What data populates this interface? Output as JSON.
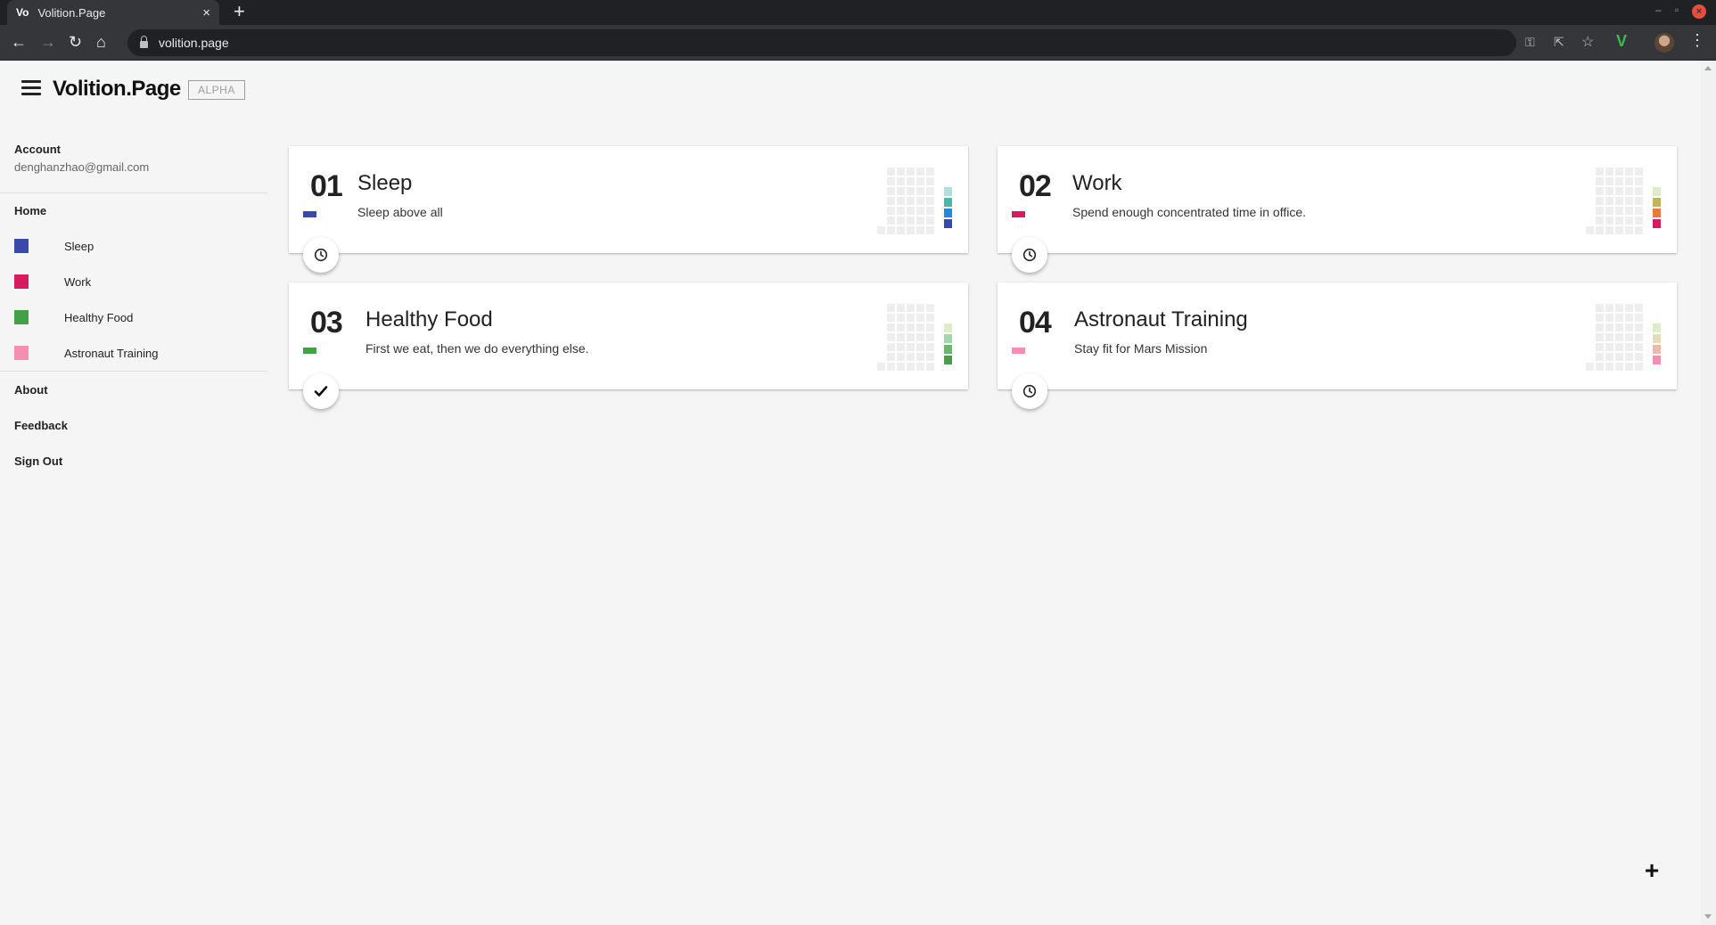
{
  "browser": {
    "tab_favicon": "Vo",
    "tab_title": "Volition.Page",
    "tab_close": "×",
    "new_tab": "+",
    "url": "volition.page",
    "icons": {
      "back": "←",
      "forward": "→",
      "reload": "↻",
      "home": "⌂",
      "key": "⚿",
      "share": "⇱",
      "star": "☆",
      "menu": "⋮",
      "extension": "V",
      "minimize": "–",
      "maximize": "▫",
      "close": "×"
    }
  },
  "header": {
    "brand": "Volition.Page",
    "badge": "ALPHA"
  },
  "sidebar": {
    "account_label": "Account",
    "account_email": "denghanzhao@gmail.com",
    "home": "Home",
    "goals": [
      {
        "label": "Sleep",
        "color": "#3949ab"
      },
      {
        "label": "Work",
        "color": "#d81b60"
      },
      {
        "label": "Healthy Food",
        "color": "#43a047"
      },
      {
        "label": "Astronaut Training",
        "color": "#f48fb1"
      }
    ],
    "about": "About",
    "feedback": "Feedback",
    "sign_out": "Sign Out"
  },
  "cards": [
    {
      "number": "01",
      "title": "Sleep",
      "description": "Sleep above all",
      "color": "#3949ab",
      "action_icon": "clock-icon",
      "stack": [
        "#b2dfdb",
        "#4db6ac",
        "#1e88e5",
        "#3949ab"
      ]
    },
    {
      "number": "02",
      "title": "Work",
      "description": "Spend enough concentrated time in office.",
      "color": "#d81b60",
      "action_icon": "clock-icon",
      "stack": [
        "#dcedc8",
        "#c5b358",
        "#e57c3a",
        "#d81b60"
      ]
    },
    {
      "number": "03",
      "title": "Healthy Food",
      "description": "First we eat, then we do everything else.",
      "color": "#43a047",
      "action_icon": "check-icon",
      "stack": [
        "#dcedc8",
        "#a5d6a7",
        "#66bb6a",
        "#43a047"
      ]
    },
    {
      "number": "04",
      "title": "Astronaut Training",
      "description": "Stay fit for Mars Mission",
      "color": "#f48fb1",
      "action_icon": "clock-icon",
      "stack": [
        "#dcedc8",
        "#e6ddb3",
        "#f0b8a8",
        "#f48fb1"
      ]
    }
  ],
  "add_button": "+"
}
